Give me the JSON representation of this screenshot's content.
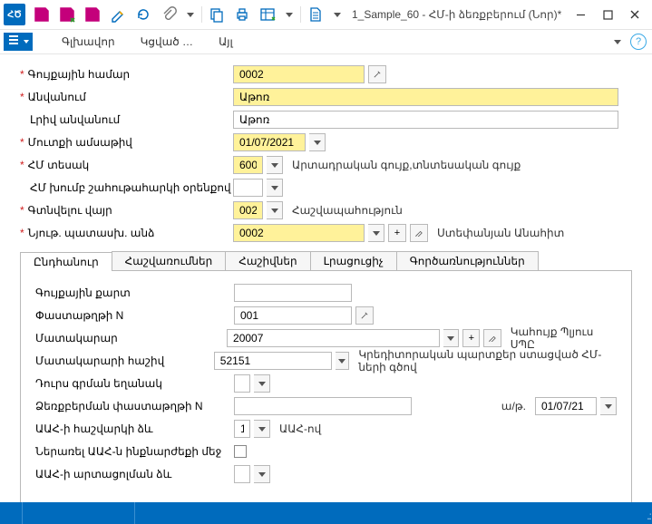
{
  "window": {
    "title": "1_Sample_60 - ՀՄ-ի ձեռքբերում (Նոր)*"
  },
  "menu": {
    "items": [
      "Գլխավոր",
      "Կցված …",
      "Այլ"
    ]
  },
  "form": {
    "inventory_number": {
      "label": "Գույքային համար",
      "value": "0002"
    },
    "name": {
      "label": "Անվանում",
      "value": "Աթոռ"
    },
    "full_name": {
      "label": "Լրիվ անվանում",
      "value": "Աթոռ"
    },
    "entry_date": {
      "label": "Մուտքի ամսաթիվ",
      "value": "01/07/2021"
    },
    "fa_type": {
      "label": "ՀՄ տեսակ",
      "value": "600",
      "desc": "Արտադրական գույք,տնտեսական գույք"
    },
    "fa_group": {
      "label": "ՀՄ խումբ շահութահարկի օրենքով",
      "value": ""
    },
    "location": {
      "label": "Գտնվելու վայր",
      "value": "002",
      "desc": "Հաշվապահություն"
    },
    "responsible": {
      "label": "Նյութ. պատասխ. անձ",
      "value": "0002",
      "desc": "Ստեփանյան Անահիտ"
    }
  },
  "tabs": {
    "items": [
      "Ընդհանուր",
      "Հաշվառումներ",
      "Հաշիվներ",
      "Լրացուցիչ",
      "Գործառնություններ"
    ],
    "active": 0,
    "general": {
      "inventory_card": {
        "label": "Գույքային քարտ",
        "value": ""
      },
      "doc_number": {
        "label": "Փաստաթղթի N",
        "value": "001"
      },
      "supplier": {
        "label": "Մատակարար",
        "value": "20007",
        "desc": "Կահույք Պլյուս ՍՊԸ"
      },
      "supplier_account": {
        "label": "Մատակարարի հաշիվ",
        "value": "52151",
        "desc": "Կրեդիտորական պարտքեր ստացված ՀՄ-ների գծով"
      },
      "expense_method": {
        "label": "Դուրս գրման եղանակ",
        "value": ""
      },
      "acq_doc_number": {
        "label": "Ձեռքբերման փաստաթղթի N",
        "value": ""
      },
      "acq_date": {
        "label_inline": "ա/թ.",
        "value": "01/07/21"
      },
      "vat_method": {
        "label": "ԱԱՀ-ի հաշվարկի ձև",
        "value": "1",
        "desc": "ԱԱՀ-ով"
      },
      "vat_in_cost": {
        "label": "Ներառել ԱԱՀ-ն ինքնարժեքի մեջ"
      },
      "vat_reflection": {
        "label": "ԱԱՀ-ի արտացոլման ձև",
        "value": ""
      }
    }
  }
}
